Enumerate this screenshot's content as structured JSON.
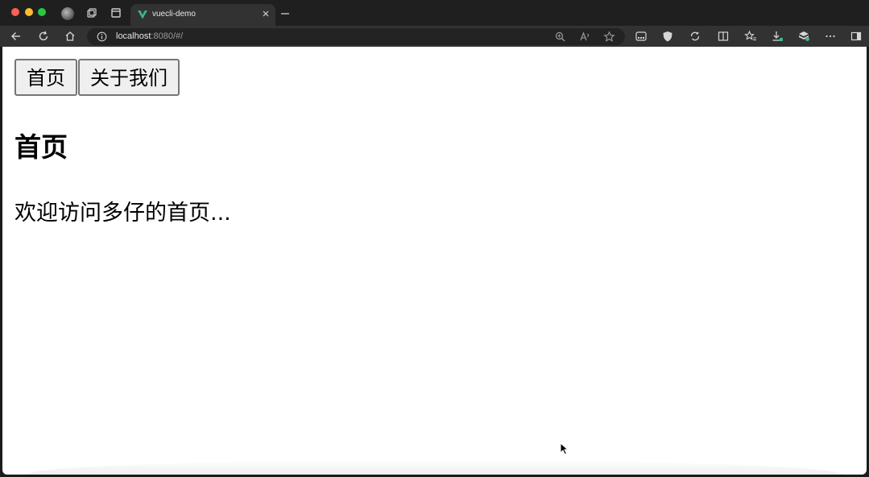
{
  "browser": {
    "tab_title": "vuecli-demo",
    "url_host": "localhost",
    "url_rest": ":8080/#/",
    "icons": [
      "profile-icon",
      "workspaces-icon",
      "tab-actions-icon",
      "vue-favicon-icon",
      "close-icon",
      "new-tab-icon",
      "back-icon",
      "refresh-icon",
      "home-icon",
      "site-info-icon",
      "zoom-icon",
      "read-aloud-icon",
      "favorite-star-icon",
      "extension-icon",
      "shield-icon",
      "sync-icon",
      "split-screen-icon",
      "favorites-icon",
      "downloads-icon",
      "extensions-icon",
      "more-icon",
      "sidebar-icon"
    ],
    "accent_color": "#41b883"
  },
  "page": {
    "buttons": [
      {
        "label": "首页"
      },
      {
        "label": "关于我们"
      }
    ],
    "title": "首页",
    "welcome_text": "欢迎访问多仔的首页..."
  }
}
